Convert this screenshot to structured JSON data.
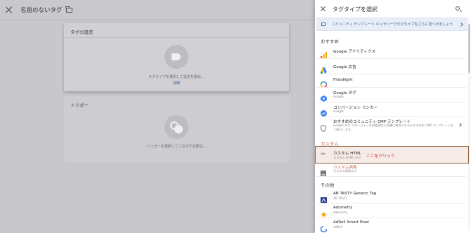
{
  "editor": {
    "title": "名前のないタグ",
    "tag_card": {
      "title": "タグの設定",
      "hint": "タグタイプを選択して設定を開始…",
      "link": "詳細"
    },
    "trigger_card": {
      "title": "トリガー",
      "hint": "トリガーを選択してこのタグを配信…"
    }
  },
  "panel": {
    "title": "タグタイプを選択",
    "banner_text": "コミュニティ テンプレート ギャラリーでタグタイプをさらに見つけましょう",
    "sections": {
      "recommended": "おすすめ",
      "custom": "カスタム",
      "other": "その他"
    },
    "recommended_items": [
      {
        "name": "Google アナリティクス",
        "sub": "",
        "icon": "analytics-icon"
      },
      {
        "name": "Google 広告",
        "sub": "",
        "icon": "google-ads-icon"
      },
      {
        "name": "Floodlight",
        "sub": "",
        "icon": "floodlight-icon"
      },
      {
        "name": "Google タグ",
        "sub": "Google",
        "icon": "google-tag-icon"
      },
      {
        "name": "コンバージョン リンカー",
        "sub": "Google",
        "icon": "conversion-linker-icon"
      },
      {
        "name": "おすすめのコミュニティ CMP テンプレート",
        "sub": "Google タグ マネージャーの同意設定と実績に統合できるおすすめの CMP テンプレートをご紹介します。",
        "icon": "shield-icon"
      }
    ],
    "custom_items": [
      {
        "name": "カスタム HTML",
        "sub": "カスタム HTML タグ",
        "note": "ここをクリック",
        "icon": "code-icon"
      },
      {
        "name": "カスタム画像",
        "sub": "カスタム画像タグ",
        "icon": "image-icon"
      }
    ],
    "other_items": [
      {
        "name": "AB TASTY Generic Tag",
        "sub": "AB TASTY",
        "icon": "abtasty-icon"
      },
      {
        "name": "Adometry",
        "sub": "Adometry",
        "icon": "adometry-icon"
      },
      {
        "name": "AdRoll Smart Pixel",
        "sub": "AdRoll",
        "icon": "adroll-icon"
      }
    ]
  }
}
